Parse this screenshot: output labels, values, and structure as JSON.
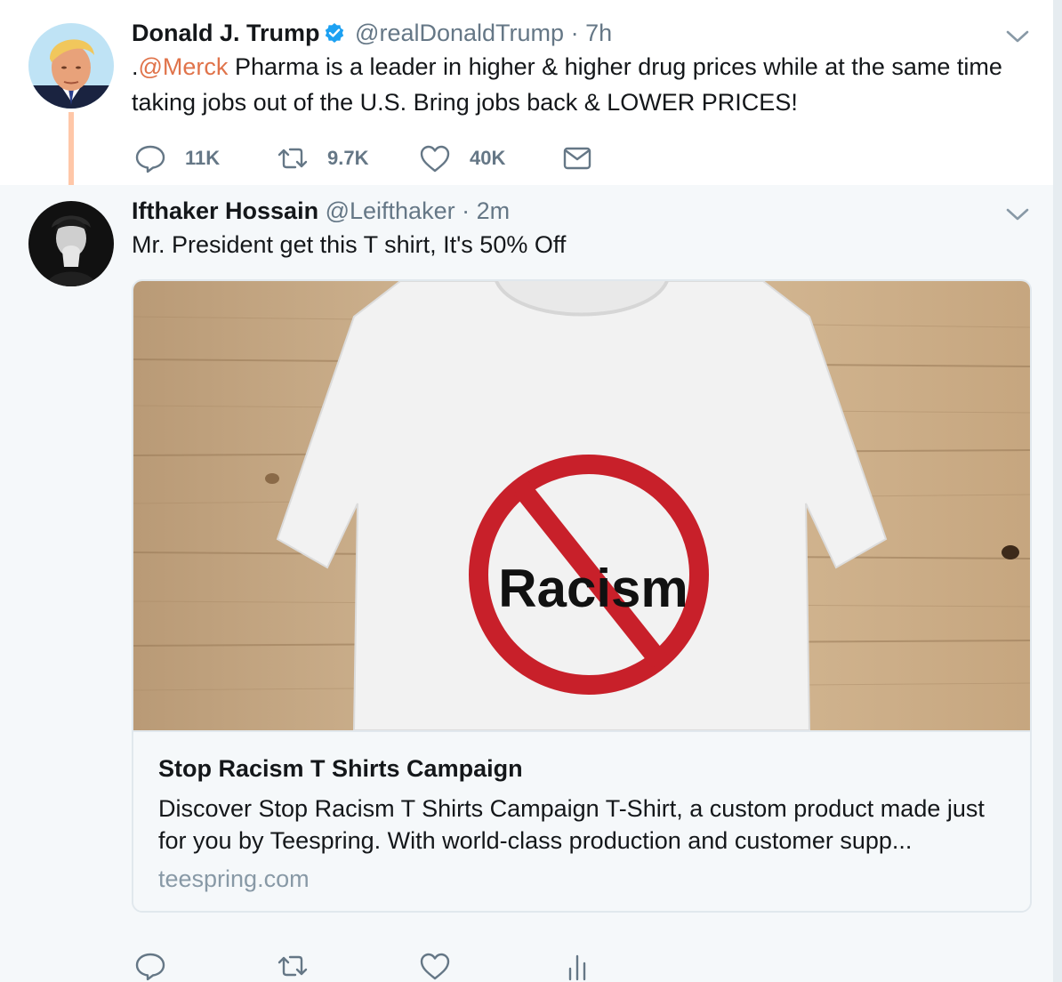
{
  "tweets": [
    {
      "name": "Donald J. Trump",
      "verified": true,
      "handle": "@realDonaldTrump",
      "separator": "·",
      "time": "7h",
      "text_prefix": ".",
      "mention": "@Merck",
      "text": " Pharma is a leader in higher & higher drug prices while at the same time taking jobs out of the U.S. Bring jobs back & LOWER PRICES!",
      "actions": {
        "replies": "11K",
        "retweets": "9.7K",
        "likes": "40K"
      }
    },
    {
      "name": "Ifthaker Hossain",
      "handle": "@Leifthaker",
      "separator": "·",
      "time": "2m",
      "text": "Mr. President get this T shirt, It's 50% Off",
      "card": {
        "image_text": "Racism",
        "title": "Stop Racism T Shirts Campaign",
        "description": "Discover Stop Racism T Shirts Campaign T-Shirt, a custom product made just for you by Teespring. With world-class production and customer supp...",
        "domain": "teespring.com"
      }
    }
  ],
  "colors": {
    "link": "#e0734a",
    "verified": "#1da1f2",
    "muted": "#657786",
    "thread_line": "#ffc7a8",
    "reply_bg": "#f5f8fa"
  },
  "icons": [
    "verified-badge-icon",
    "chevron-down-icon",
    "reply-icon",
    "retweet-icon",
    "like-icon",
    "direct-message-icon",
    "analytics-icon"
  ]
}
